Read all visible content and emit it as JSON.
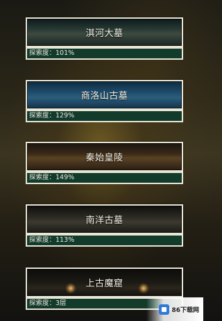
{
  "levels": [
    {
      "name": "淇河大墓",
      "progress_text": "探索度：101%"
    },
    {
      "name": "商洛山古墓",
      "progress_text": "探索度：129%"
    },
    {
      "name": "秦始皇陵",
      "progress_text": "探索度：149%"
    },
    {
      "name": "南洋古墓",
      "progress_text": "探索度：113%"
    },
    {
      "name": "上古魔窟",
      "progress_text": "探索度：3层"
    }
  ],
  "watermark": {
    "text": "86下载网",
    "icon": "86-logo-icon"
  }
}
